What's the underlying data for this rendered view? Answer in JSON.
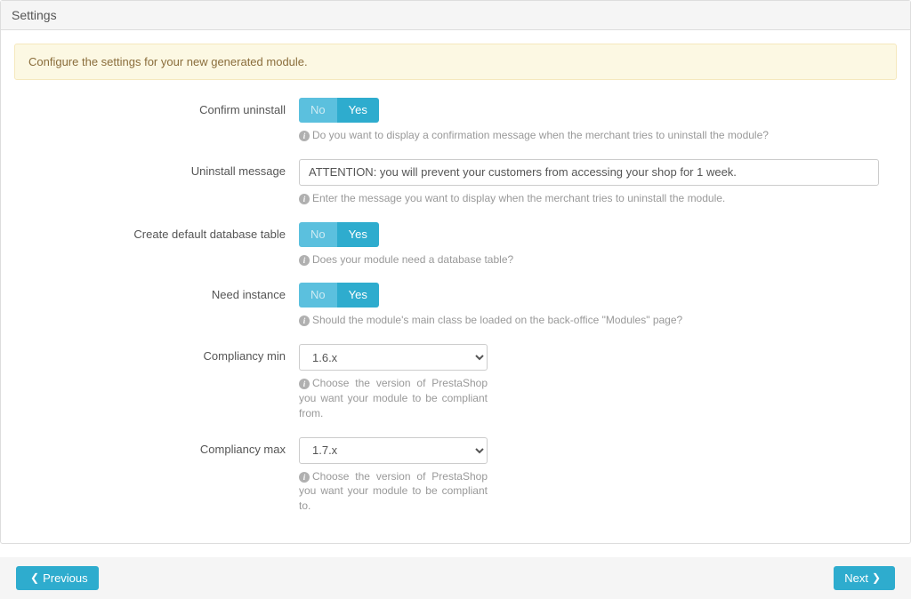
{
  "panel": {
    "heading": "Settings",
    "alert": "Configure the settings for your new generated module.",
    "toggle_labels": {
      "no": "No",
      "yes": "Yes"
    },
    "fields": {
      "confirm_uninstall": {
        "label": "Confirm uninstall",
        "value": "Yes",
        "help": "Do you want to display a confirmation message when the merchant tries to uninstall the module?"
      },
      "uninstall_message": {
        "label": "Uninstall message",
        "value": "ATTENTION: you will prevent your customers from accessing your shop for 1 week.",
        "help": "Enter the message you want to display when the merchant tries to uninstall the module."
      },
      "create_db": {
        "label": "Create default database table",
        "value": "Yes",
        "help": "Does your module need a database table?"
      },
      "need_instance": {
        "label": "Need instance",
        "value": "Yes",
        "help": "Should the module's main class be loaded on the back-office \"Modules\" page?"
      },
      "compliancy_min": {
        "label": "Compliancy min",
        "value": "1.6.x",
        "help": "Choose the version of PrestaShop you want your module to be compliant from."
      },
      "compliancy_max": {
        "label": "Compliancy max",
        "value": "1.7.x",
        "help": "Choose the version of PrestaShop you want your module to be compliant to."
      }
    }
  },
  "footer": {
    "previous_label": "Previous",
    "next_label": "Next"
  }
}
